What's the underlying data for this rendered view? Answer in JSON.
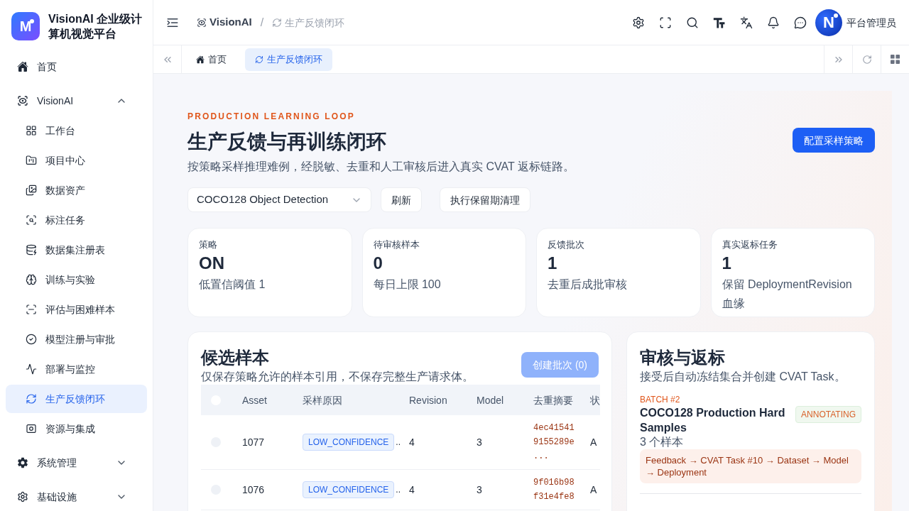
{
  "sidebar": {
    "logo": {
      "mark": "M"
    },
    "title": "VisionAI 企业级计算机视觉平台",
    "items": [
      {
        "label": "首页",
        "selected": false
      },
      {
        "label": "VisionAI",
        "selected": false,
        "expanded": true,
        "children": [
          {
            "label": "工作台",
            "selected": false
          },
          {
            "label": "项目中心",
            "selected": false
          },
          {
            "label": "数据资产",
            "selected": false
          },
          {
            "label": "标注任务",
            "selected": false
          },
          {
            "label": "数据集注册表",
            "selected": false
          },
          {
            "label": "训练与实验",
            "selected": false
          },
          {
            "label": "评估与困难样本",
            "selected": false
          },
          {
            "label": "模型注册与审批",
            "selected": false
          },
          {
            "label": "部署与监控",
            "selected": false
          },
          {
            "label": "生产反馈闭环",
            "selected": true
          },
          {
            "label": "资源与集成",
            "selected": false
          }
        ]
      },
      {
        "label": "系统管理",
        "selected": false,
        "expanded": false
      },
      {
        "label": "基础设施",
        "selected": false,
        "expanded": false
      }
    ]
  },
  "header": {
    "breadcrumbs": [
      {
        "label": "VisionAI"
      },
      {
        "label": "生产反馈闭环"
      }
    ],
    "separator": "/",
    "user": {
      "initial": "N",
      "name": "平台管理员"
    }
  },
  "tabs": [
    {
      "label": "首页",
      "selected": false
    },
    {
      "label": "生产反馈闭环",
      "selected": true
    }
  ],
  "hero": {
    "eyebrow": "PRODUCTION LEARNING LOOP",
    "title": "生产反馈与再训练闭环",
    "subtitle": "按策略采样推理难例，经脱敏、去重和人工审核后进入真实 CVAT 返标链路。",
    "primary_button": "配置采样策略",
    "dataset_select": {
      "value": "COCO128 Object Detection"
    },
    "buttons": [
      "刷新",
      "执行保留期清理"
    ]
  },
  "stats": [
    {
      "label": "策略",
      "value": "ON",
      "note": "低置信阈值 1"
    },
    {
      "label": "待审核样本",
      "value": "0",
      "note": "每日上限 100"
    },
    {
      "label": "反馈批次",
      "value": "1",
      "note": "去重后成批审核"
    },
    {
      "label": "真实返标任务",
      "value": "1",
      "note": "保留 DeploymentRevision 血缘"
    }
  ],
  "candidates": {
    "title": "候选样本",
    "subtitle": "仅保存策略允许的样本引用，不保存完整生产请求体。",
    "create_button": {
      "label": "创建批次 (0)",
      "disabled": true
    },
    "table": {
      "columns": [
        "Asset",
        "采样原因",
        "Revision",
        "Model",
        "去重摘要",
        "状"
      ],
      "select_all": {
        "checked": false
      },
      "rows": [
        {
          "selected": false,
          "asset": "1077",
          "reason": "LOW_CONFIDENCE",
          "more": "..",
          "revision": "4",
          "model": "3",
          "digest": "4ec415419155289e...",
          "status": "A"
        },
        {
          "selected": false,
          "asset": "1076",
          "reason": "LOW_CONFIDENCE",
          "more": "..",
          "revision": "4",
          "model": "3",
          "digest": "9f016b98f31e4fe8",
          "status": "A"
        }
      ]
    }
  },
  "review": {
    "title": "审核与返标",
    "subtitle": "接受后自动冻结集合并创建 CVAT Task。",
    "batch": {
      "tag": "BATCH #2",
      "name": "COCO128 Production Hard Samples",
      "status": "ANNOTATING",
      "count": "3 个样本",
      "lineage": "Feedback → CVAT Task #10 → Dataset → Model → Deployment"
    }
  }
}
